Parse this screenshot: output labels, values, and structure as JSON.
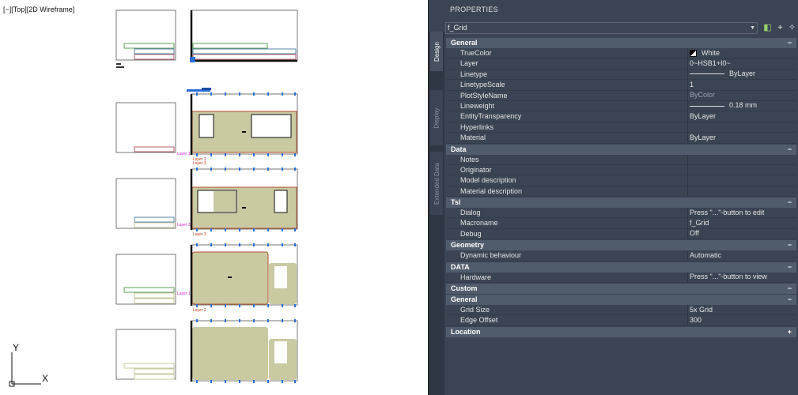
{
  "viewport": {
    "label": "[−][Top][2D Wireframe]",
    "axis_x": "X",
    "axis_y": "Y",
    "layer_labels": [
      "Layer 1",
      "Layer 2",
      "Layer 3",
      "Layer 3",
      "Layer 1",
      "Layer 2",
      "Layer 3"
    ]
  },
  "palette": {
    "title": "PROPERTIES",
    "tabs": [
      {
        "label": "Design",
        "active": true
      },
      {
        "label": "Display",
        "active": false
      },
      {
        "label": "Extended Data",
        "active": false
      }
    ],
    "selector_value": "f_Grid",
    "toolbar_icons": [
      "toggle-pickadd-icon",
      "select-objects-icon",
      "quick-select-icon"
    ],
    "categories": [
      {
        "name": "General",
        "toggle": "−",
        "rows": [
          {
            "key": "TrueColor",
            "value": "White",
            "kind": "color"
          },
          {
            "key": "Layer",
            "value": "0~HSB1+I0~"
          },
          {
            "key": "Linetype",
            "value": "ByLayer",
            "kind": "line"
          },
          {
            "key": "LinetypeScale",
            "value": "1"
          },
          {
            "key": "PlotStyleName",
            "value": "ByColor",
            "muted": true
          },
          {
            "key": "Lineweight",
            "value": "0.18 mm",
            "kind": "line"
          },
          {
            "key": "EntityTransparency",
            "value": "ByLayer"
          },
          {
            "key": "Hyperlinks",
            "value": ""
          },
          {
            "key": "Material",
            "value": "ByLayer"
          }
        ]
      },
      {
        "name": "Data",
        "toggle": "−",
        "rows": [
          {
            "key": "Notes",
            "value": ""
          },
          {
            "key": "Originator",
            "value": ""
          },
          {
            "key": "Model description",
            "value": ""
          },
          {
            "key": "Material description",
            "value": ""
          }
        ]
      },
      {
        "name": "Tsl",
        "toggle": "−",
        "rows": [
          {
            "key": "Dialog",
            "value": "Press \"...\"-button to edit"
          },
          {
            "key": "Macroname",
            "value": "f_Grid"
          },
          {
            "key": "Debug",
            "value": "Off"
          }
        ]
      },
      {
        "name": "Geometry",
        "toggle": "−",
        "rows": [
          {
            "key": "Dynamic behaviour",
            "value": "Automatic"
          }
        ]
      },
      {
        "name": "DATA",
        "toggle": "−",
        "rows": [
          {
            "key": "Hardware",
            "value": "Press \"...\"-button to view"
          }
        ]
      },
      {
        "name": "Custom",
        "toggle": "−",
        "rows": []
      },
      {
        "name": "General",
        "toggle": "−",
        "rows": [
          {
            "key": "Grid Size",
            "value": "5x Grid"
          },
          {
            "key": "Edge Offset",
            "value": "300"
          }
        ]
      },
      {
        "name": "Location",
        "toggle": "+",
        "rows": []
      }
    ]
  }
}
